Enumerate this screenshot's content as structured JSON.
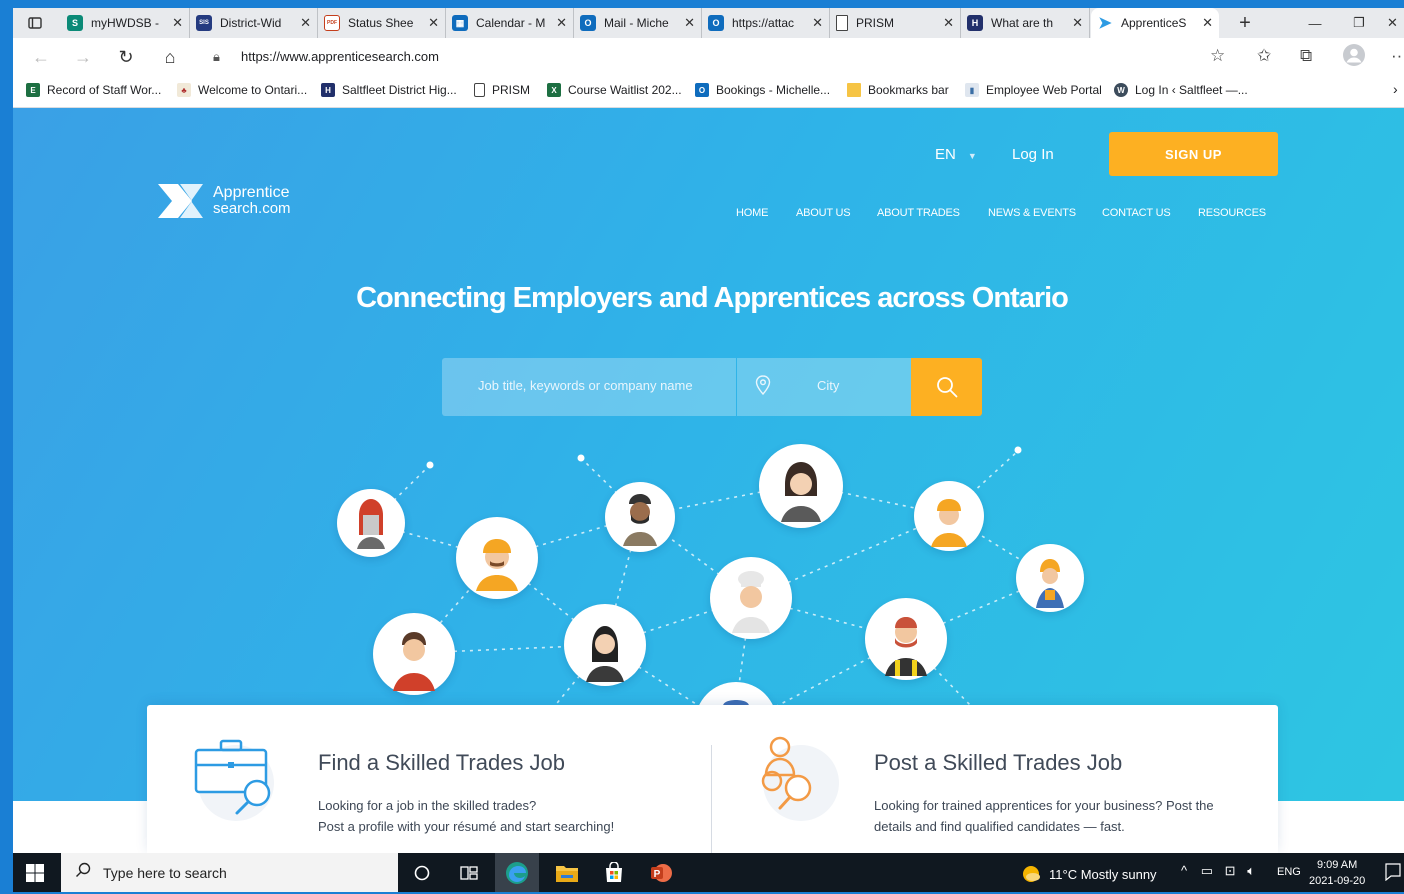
{
  "browser": {
    "tabs": [
      {
        "label": "myHWDSB -",
        "color": "#0b8a77",
        "glyph": "S"
      },
      {
        "label": "District-Wid",
        "color": "#253b80",
        "glyph": "SIS"
      },
      {
        "label": "Status Shee",
        "color": "#c43e1c",
        "glyph": "PDF"
      },
      {
        "label": "Calendar - M",
        "color": "#0f6cbd",
        "glyph": ""
      },
      {
        "label": "Mail - Miche",
        "color": "#0f6cbd",
        "glyph": "O"
      },
      {
        "label": "https://attac",
        "color": "#0f6cbd",
        "glyph": "O"
      },
      {
        "label": "PRISM",
        "color": "",
        "glyph": ""
      },
      {
        "label": "What are th",
        "color": "#22306b",
        "glyph": "H"
      },
      {
        "label": "ApprenticeS",
        "color": "#2d9be3",
        "glyph": "›"
      }
    ],
    "address": "https://www.apprenticesearch.com",
    "bookmarks": [
      "Record of Staff Wor...",
      "Welcome to Ontari...",
      "Saltfleet District Hig...",
      "PRISM",
      "Course Waitlist 202...",
      "Bookings - Michelle...",
      "Bookmarks bar",
      "Employee Web Portal",
      "Log In ‹ Saltfleet —..."
    ]
  },
  "site": {
    "lang": "EN",
    "login": "Log In",
    "signup": "SIGN UP",
    "logo_line1": "Apprentice",
    "logo_line2": "search.com",
    "nav": [
      "HOME",
      "ABOUT US",
      "ABOUT TRADES",
      "NEWS & EVENTS",
      "CONTACT US",
      "RESOURCES"
    ],
    "headline": "Connecting Employers and Apprentices across Ontario",
    "search": {
      "keyword_placeholder": "Job title, keywords or company name",
      "city_placeholder": "City"
    },
    "cards": [
      {
        "title": "Find a Skilled Trades Job",
        "line1": "Looking for a job in the skilled trades?",
        "line2": "Post a profile with your résumé and start searching!"
      },
      {
        "title": "Post a Skilled Trades Job",
        "line1": "Looking for trained apprentices for your business? Post the",
        "line2": "details and find qualified candidates — fast."
      }
    ],
    "colors": {
      "accent": "#fdb022",
      "sky": "#2fb3e8",
      "icon_blue": "#2d9be3",
      "icon_orange": "#f39a45"
    }
  },
  "taskbar": {
    "search_placeholder": "Type here to search",
    "weather": "11°C  Mostly sunny",
    "lang": "ENG",
    "time": "9:09 AM",
    "date": "2021-09-20"
  }
}
